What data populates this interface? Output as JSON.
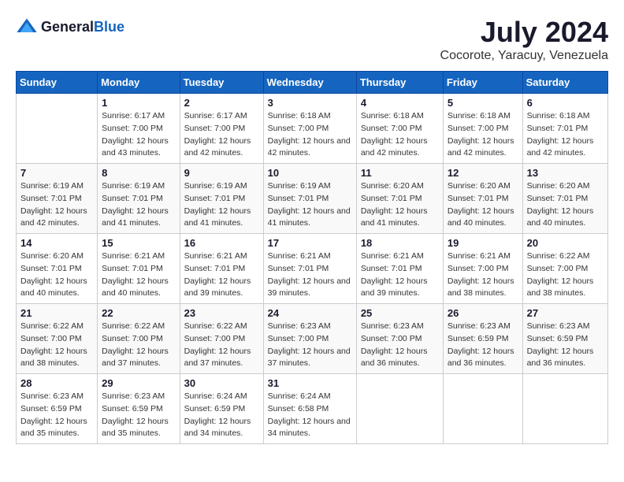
{
  "header": {
    "logo_general": "General",
    "logo_blue": "Blue",
    "title": "July 2024",
    "subtitle": "Cocorote, Yaracuy, Venezuela"
  },
  "days_of_week": [
    "Sunday",
    "Monday",
    "Tuesday",
    "Wednesday",
    "Thursday",
    "Friday",
    "Saturday"
  ],
  "weeks": [
    [
      {
        "day": "",
        "sunrise": "",
        "sunset": "",
        "daylight": ""
      },
      {
        "day": "1",
        "sunrise": "Sunrise: 6:17 AM",
        "sunset": "Sunset: 7:00 PM",
        "daylight": "Daylight: 12 hours and 43 minutes."
      },
      {
        "day": "2",
        "sunrise": "Sunrise: 6:17 AM",
        "sunset": "Sunset: 7:00 PM",
        "daylight": "Daylight: 12 hours and 42 minutes."
      },
      {
        "day": "3",
        "sunrise": "Sunrise: 6:18 AM",
        "sunset": "Sunset: 7:00 PM",
        "daylight": "Daylight: 12 hours and 42 minutes."
      },
      {
        "day": "4",
        "sunrise": "Sunrise: 6:18 AM",
        "sunset": "Sunset: 7:00 PM",
        "daylight": "Daylight: 12 hours and 42 minutes."
      },
      {
        "day": "5",
        "sunrise": "Sunrise: 6:18 AM",
        "sunset": "Sunset: 7:00 PM",
        "daylight": "Daylight: 12 hours and 42 minutes."
      },
      {
        "day": "6",
        "sunrise": "Sunrise: 6:18 AM",
        "sunset": "Sunset: 7:01 PM",
        "daylight": "Daylight: 12 hours and 42 minutes."
      }
    ],
    [
      {
        "day": "7",
        "sunrise": "Sunrise: 6:19 AM",
        "sunset": "Sunset: 7:01 PM",
        "daylight": "Daylight: 12 hours and 42 minutes."
      },
      {
        "day": "8",
        "sunrise": "Sunrise: 6:19 AM",
        "sunset": "Sunset: 7:01 PM",
        "daylight": "Daylight: 12 hours and 41 minutes."
      },
      {
        "day": "9",
        "sunrise": "Sunrise: 6:19 AM",
        "sunset": "Sunset: 7:01 PM",
        "daylight": "Daylight: 12 hours and 41 minutes."
      },
      {
        "day": "10",
        "sunrise": "Sunrise: 6:19 AM",
        "sunset": "Sunset: 7:01 PM",
        "daylight": "Daylight: 12 hours and 41 minutes."
      },
      {
        "day": "11",
        "sunrise": "Sunrise: 6:20 AM",
        "sunset": "Sunset: 7:01 PM",
        "daylight": "Daylight: 12 hours and 41 minutes."
      },
      {
        "day": "12",
        "sunrise": "Sunrise: 6:20 AM",
        "sunset": "Sunset: 7:01 PM",
        "daylight": "Daylight: 12 hours and 40 minutes."
      },
      {
        "day": "13",
        "sunrise": "Sunrise: 6:20 AM",
        "sunset": "Sunset: 7:01 PM",
        "daylight": "Daylight: 12 hours and 40 minutes."
      }
    ],
    [
      {
        "day": "14",
        "sunrise": "Sunrise: 6:20 AM",
        "sunset": "Sunset: 7:01 PM",
        "daylight": "Daylight: 12 hours and 40 minutes."
      },
      {
        "day": "15",
        "sunrise": "Sunrise: 6:21 AM",
        "sunset": "Sunset: 7:01 PM",
        "daylight": "Daylight: 12 hours and 40 minutes."
      },
      {
        "day": "16",
        "sunrise": "Sunrise: 6:21 AM",
        "sunset": "Sunset: 7:01 PM",
        "daylight": "Daylight: 12 hours and 39 minutes."
      },
      {
        "day": "17",
        "sunrise": "Sunrise: 6:21 AM",
        "sunset": "Sunset: 7:01 PM",
        "daylight": "Daylight: 12 hours and 39 minutes."
      },
      {
        "day": "18",
        "sunrise": "Sunrise: 6:21 AM",
        "sunset": "Sunset: 7:01 PM",
        "daylight": "Daylight: 12 hours and 39 minutes."
      },
      {
        "day": "19",
        "sunrise": "Sunrise: 6:21 AM",
        "sunset": "Sunset: 7:00 PM",
        "daylight": "Daylight: 12 hours and 38 minutes."
      },
      {
        "day": "20",
        "sunrise": "Sunrise: 6:22 AM",
        "sunset": "Sunset: 7:00 PM",
        "daylight": "Daylight: 12 hours and 38 minutes."
      }
    ],
    [
      {
        "day": "21",
        "sunrise": "Sunrise: 6:22 AM",
        "sunset": "Sunset: 7:00 PM",
        "daylight": "Daylight: 12 hours and 38 minutes."
      },
      {
        "day": "22",
        "sunrise": "Sunrise: 6:22 AM",
        "sunset": "Sunset: 7:00 PM",
        "daylight": "Daylight: 12 hours and 37 minutes."
      },
      {
        "day": "23",
        "sunrise": "Sunrise: 6:22 AM",
        "sunset": "Sunset: 7:00 PM",
        "daylight": "Daylight: 12 hours and 37 minutes."
      },
      {
        "day": "24",
        "sunrise": "Sunrise: 6:23 AM",
        "sunset": "Sunset: 7:00 PM",
        "daylight": "Daylight: 12 hours and 37 minutes."
      },
      {
        "day": "25",
        "sunrise": "Sunrise: 6:23 AM",
        "sunset": "Sunset: 7:00 PM",
        "daylight": "Daylight: 12 hours and 36 minutes."
      },
      {
        "day": "26",
        "sunrise": "Sunrise: 6:23 AM",
        "sunset": "Sunset: 6:59 PM",
        "daylight": "Daylight: 12 hours and 36 minutes."
      },
      {
        "day": "27",
        "sunrise": "Sunrise: 6:23 AM",
        "sunset": "Sunset: 6:59 PM",
        "daylight": "Daylight: 12 hours and 36 minutes."
      }
    ],
    [
      {
        "day": "28",
        "sunrise": "Sunrise: 6:23 AM",
        "sunset": "Sunset: 6:59 PM",
        "daylight": "Daylight: 12 hours and 35 minutes."
      },
      {
        "day": "29",
        "sunrise": "Sunrise: 6:23 AM",
        "sunset": "Sunset: 6:59 PM",
        "daylight": "Daylight: 12 hours and 35 minutes."
      },
      {
        "day": "30",
        "sunrise": "Sunrise: 6:24 AM",
        "sunset": "Sunset: 6:59 PM",
        "daylight": "Daylight: 12 hours and 34 minutes."
      },
      {
        "day": "31",
        "sunrise": "Sunrise: 6:24 AM",
        "sunset": "Sunset: 6:58 PM",
        "daylight": "Daylight: 12 hours and 34 minutes."
      },
      {
        "day": "",
        "sunrise": "",
        "sunset": "",
        "daylight": ""
      },
      {
        "day": "",
        "sunrise": "",
        "sunset": "",
        "daylight": ""
      },
      {
        "day": "",
        "sunrise": "",
        "sunset": "",
        "daylight": ""
      }
    ]
  ]
}
